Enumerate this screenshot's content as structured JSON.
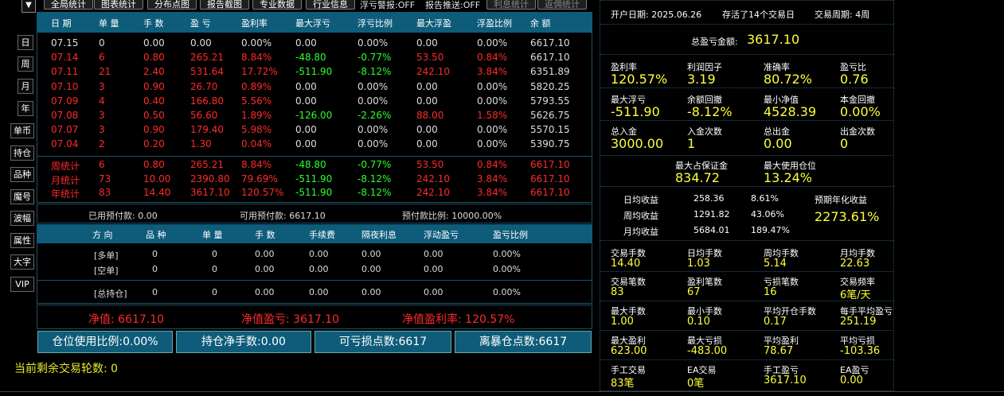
{
  "toolbar": {
    "dropdown_glyph": "▼",
    "buttons": [
      "全局统计",
      "图表统计",
      "分布点图",
      "报告截图",
      "专业数据",
      "行业信息"
    ],
    "float_warn": "浮亏警报:OFF",
    "report_push": "报告推送:OFF",
    "dim_buttons": [
      "利息统计",
      "返佣统计"
    ]
  },
  "sidebar": {
    "periods": [
      "日",
      "周",
      "月",
      "年"
    ],
    "tools": [
      "单币",
      "持仓",
      "品种",
      "魔号",
      "波幅",
      "属性",
      "大字",
      "VIP"
    ]
  },
  "stats_table": {
    "headers": [
      "日 期",
      "单 量",
      "手 数",
      "盈 亏",
      "盈利率",
      "最大浮亏",
      "浮亏比例",
      "最大浮盈",
      "浮盈比例",
      "余 额"
    ],
    "rows": [
      {
        "c": [
          "07.15",
          "0",
          "0.00",
          "0.00",
          "0.00%",
          "0.00",
          "0.00%",
          "0.00",
          "0.00%",
          "6617.10"
        ],
        "color": "wht"
      },
      {
        "c": [
          "07.14",
          "6",
          "0.80",
          "265.21",
          "8.84%",
          "-48.80",
          "-0.77%",
          "53.50",
          "0.84%",
          "6617.10"
        ],
        "color": "red"
      },
      {
        "c": [
          "07.11",
          "21",
          "2.40",
          "531.64",
          "17.72%",
          "-511.90",
          "-8.12%",
          "242.10",
          "3.84%",
          "6351.89"
        ],
        "color": "red"
      },
      {
        "c": [
          "07.10",
          "3",
          "0.90",
          "26.70",
          "0.89%",
          "0.00",
          "0.00%",
          "0.00",
          "0.00%",
          "5820.25"
        ],
        "color": "red"
      },
      {
        "c": [
          "07.09",
          "4",
          "0.40",
          "166.80",
          "5.56%",
          "0.00",
          "0.00%",
          "0.00",
          "0.00%",
          "5793.55"
        ],
        "color": "red"
      },
      {
        "c": [
          "07.08",
          "3",
          "0.50",
          "56.60",
          "1.89%",
          "-126.00",
          "-2.26%",
          "88.00",
          "1.58%",
          "5626.75"
        ],
        "color": "red"
      },
      {
        "c": [
          "07.07",
          "3",
          "0.90",
          "179.40",
          "5.98%",
          "0.00",
          "0.00%",
          "0.00",
          "0.00%",
          "5570.15"
        ],
        "color": "red"
      },
      {
        "c": [
          "07.04",
          "2",
          "0.20",
          "1.30",
          "0.04%",
          "0.00",
          "0.00%",
          "0.00",
          "0.00%",
          "5390.75"
        ],
        "color": "red"
      }
    ],
    "summary": [
      {
        "c": [
          "周统计",
          "6",
          "0.80",
          "265.21",
          "8.84%",
          "-48.80",
          "-0.77%",
          "53.50",
          "0.84%",
          "6617.10"
        ]
      },
      {
        "c": [
          "月统计",
          "73",
          "10.00",
          "2390.80",
          "79.69%",
          "-511.90",
          "-8.12%",
          "242.10",
          "3.84%",
          "6617.10"
        ]
      },
      {
        "c": [
          "年统计",
          "83",
          "14.40",
          "3617.10",
          "120.57%",
          "-511.90",
          "-8.12%",
          "242.10",
          "3.84%",
          "6617.10"
        ]
      }
    ]
  },
  "prepay": {
    "used": "已用预付款: 0.00",
    "available": "可用预付款: 6617.10",
    "ratio": "预付款比例: 10000.00%"
  },
  "positions": {
    "headers": [
      "方 向",
      "品 种",
      "单 量",
      "手 数",
      "手续费",
      "隔夜利息",
      "浮动盈亏",
      "盈亏比例"
    ],
    "rows": [
      [
        "[多单]",
        "0",
        "0",
        "0.00",
        "0.00",
        "0.00",
        "0.00",
        "0.00%"
      ],
      [
        "[空单]",
        "0",
        "0",
        "0.00",
        "0.00",
        "0.00",
        "0.00",
        "0.00%"
      ],
      [
        "[总持仓]",
        "0",
        "0",
        "0.00",
        "0.00",
        "0.00",
        "0.00",
        "0.00%"
      ]
    ]
  },
  "net": {
    "net_value": "净值: 6617.10",
    "net_pnl": "净值盈亏: 3617.10",
    "net_rate": "净值盈利率: 120.57%"
  },
  "bottom_buttons": [
    "仓位使用比例:0.00%",
    "持仓净手数:0.00",
    "可亏损点数:6617",
    "离暴仓点数:6617"
  ],
  "remaining_rounds": "当前剩余交易轮数: 0",
  "right": {
    "open_date": "开户日期: 2025.06.26",
    "survived": "存活了14个交易日",
    "cycle": "交易周期: 4周",
    "total_pnl_label": "总盈亏金额:",
    "total_pnl_value": "3617.10",
    "g1": [
      {
        "l": "盈利率",
        "v": "120.57%"
      },
      {
        "l": "利润因子",
        "v": "3.19"
      },
      {
        "l": "准确率",
        "v": "80.72%"
      },
      {
        "l": "盈亏比",
        "v": "0.76"
      },
      {
        "l": "最大浮亏",
        "v": "-511.90"
      },
      {
        "l": "余额回撤",
        "v": "-8.12%"
      },
      {
        "l": "最小净值",
        "v": "4528.39"
      },
      {
        "l": "本金回撤",
        "v": "0.00%"
      },
      {
        "l": "总入金",
        "v": "3000.00"
      },
      {
        "l": "入金次数",
        "v": "1"
      },
      {
        "l": "总出金",
        "v": "0.00"
      },
      {
        "l": "出金次数",
        "v": "0"
      }
    ],
    "margin": [
      {
        "l": "最大占保证金",
        "v": "834.72"
      },
      {
        "l": "最大使用仓位",
        "v": "13.24%"
      }
    ],
    "avg": [
      {
        "l": "日均收益",
        "a": "258.36",
        "p": "8.61%"
      },
      {
        "l": "周均收益",
        "a": "1291.82",
        "p": "43.06%"
      },
      {
        "l": "月均收益",
        "a": "5684.01",
        "p": "189.47%"
      }
    ],
    "annual_label": "预期年化收益",
    "annual_value": "2273.61%",
    "g2": [
      {
        "l": "交易手数",
        "v": "14.40"
      },
      {
        "l": "日均手数",
        "v": "1.03"
      },
      {
        "l": "周均手数",
        "v": "5.14"
      },
      {
        "l": "月均手数",
        "v": "22.63"
      },
      {
        "l": "交易笔数",
        "v": "83"
      },
      {
        "l": "盈利笔数",
        "v": "67"
      },
      {
        "l": "亏损笔数",
        "v": "16"
      },
      {
        "l": "交易频率",
        "v": "6笔/天"
      },
      {
        "l": "最大手数",
        "v": "1.00"
      },
      {
        "l": "最小手数",
        "v": "0.10"
      },
      {
        "l": "平均开仓手数",
        "v": "0.17"
      },
      {
        "l": "每手平均盈亏",
        "v": "251.19"
      },
      {
        "l": "最大盈利",
        "v": "623.00"
      },
      {
        "l": "最大亏损",
        "v": "-483.00"
      },
      {
        "l": "平均盈利",
        "v": "78.67"
      },
      {
        "l": "平均亏损",
        "v": "-103.36"
      },
      {
        "l": "手工交易",
        "v": "83笔"
      },
      {
        "l": "EA交易",
        "v": "0笔"
      },
      {
        "l": "手工盈亏",
        "v": "3617.10"
      },
      {
        "l": "EA盈亏",
        "v": "0.00"
      }
    ]
  },
  "colors": {
    "header_bg": "#0e5c7a",
    "profit": "#ff2a2a",
    "loss": "#2cff2c",
    "highlight": "#ffff3a"
  }
}
